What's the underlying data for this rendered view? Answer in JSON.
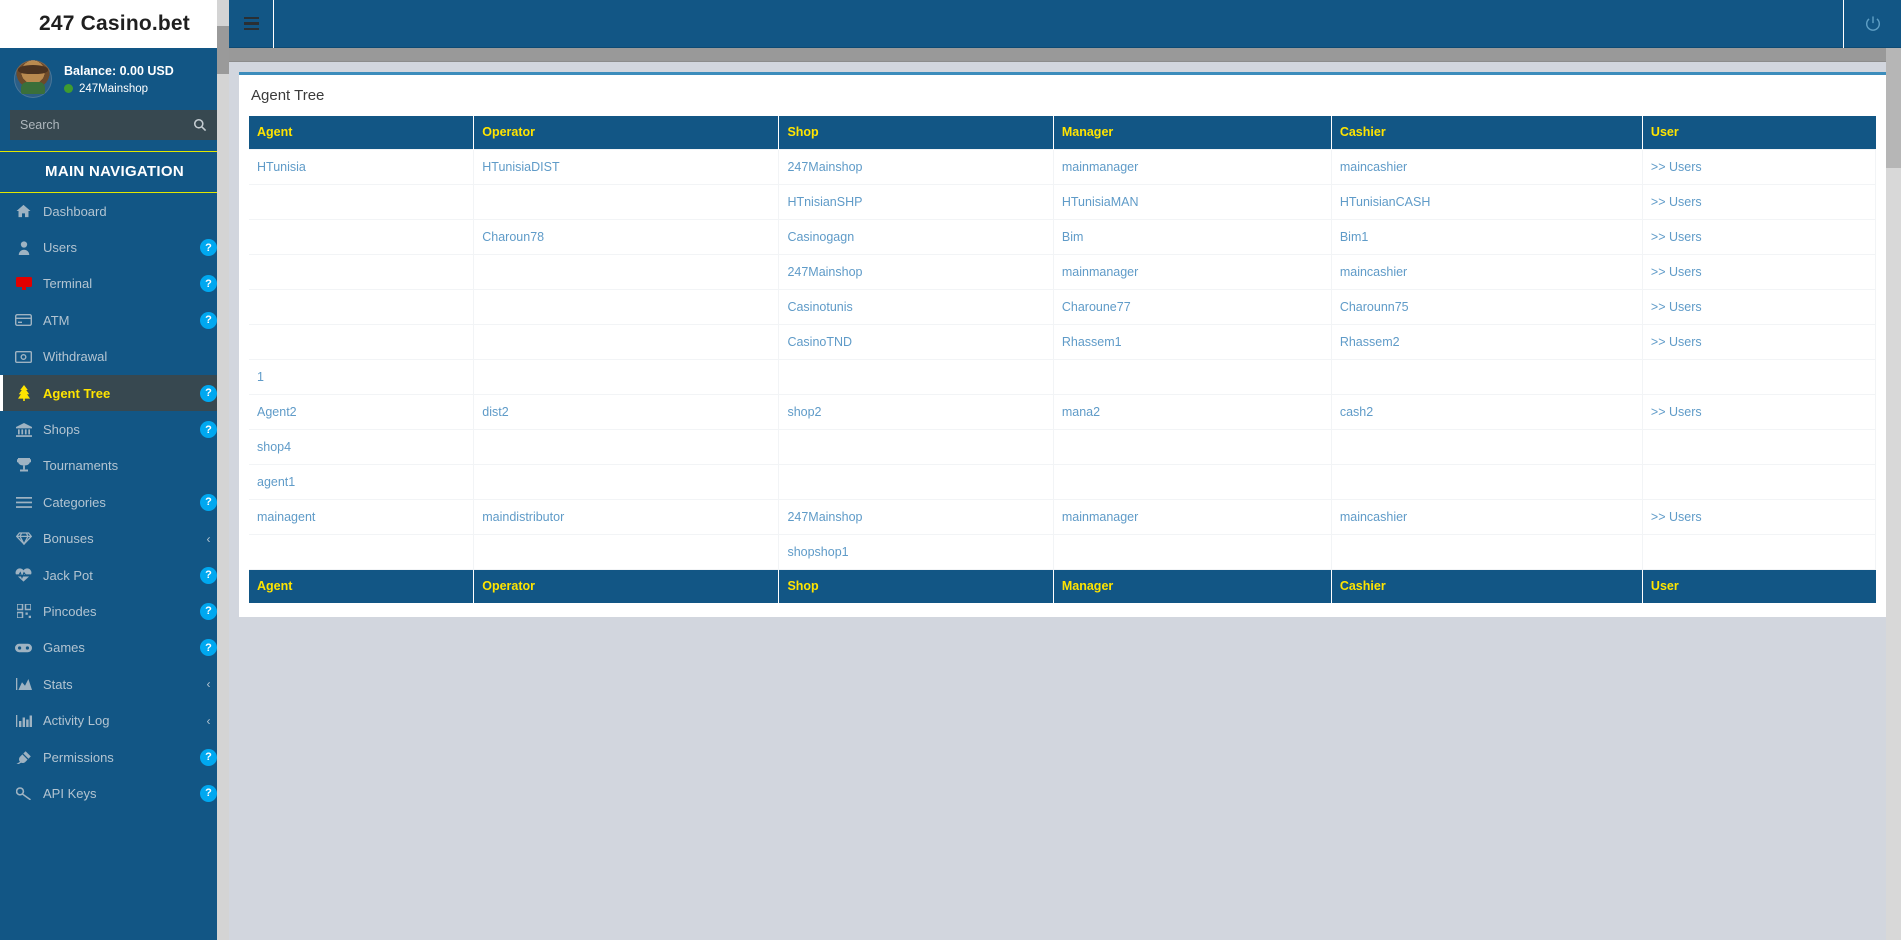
{
  "brand": {
    "name": "247 Casino.bet"
  },
  "user_panel": {
    "balance": "Balance: 0.00 USD",
    "shop": "247Mainshop",
    "status_color": "#3f9b30"
  },
  "search": {
    "placeholder": "Search",
    "value": "",
    "icon": "search-icon"
  },
  "sidebar": {
    "header": "MAIN NAVIGATION",
    "items": [
      {
        "label": "Dashboard",
        "icon": "home-icon",
        "badge": "",
        "chevron": false,
        "active": false
      },
      {
        "label": "Users",
        "icon": "user-icon",
        "badge": "?",
        "chevron": false,
        "active": false
      },
      {
        "label": "Terminal",
        "icon": "monitor-icon",
        "badge": "?",
        "chevron": false,
        "active": false
      },
      {
        "label": "ATM",
        "icon": "card-icon",
        "badge": "?",
        "chevron": false,
        "active": false
      },
      {
        "label": "Withdrawal",
        "icon": "money-icon",
        "badge": "",
        "chevron": false,
        "active": false
      },
      {
        "label": "Agent Tree",
        "icon": "tree-icon",
        "badge": "?",
        "chevron": false,
        "active": true
      },
      {
        "label": "Shops",
        "icon": "bank-icon",
        "badge": "?",
        "chevron": false,
        "active": false
      },
      {
        "label": "Tournaments",
        "icon": "trophy-icon",
        "badge": "",
        "chevron": false,
        "active": false
      },
      {
        "label": "Categories",
        "icon": "list-icon",
        "badge": "?",
        "chevron": false,
        "active": false
      },
      {
        "label": "Bonuses",
        "icon": "gem-icon",
        "badge": "",
        "chevron": true,
        "active": false
      },
      {
        "label": "Jack Pot",
        "icon": "heartbeat-icon",
        "badge": "?",
        "chevron": false,
        "active": false
      },
      {
        "label": "Pincodes",
        "icon": "qrcode-icon",
        "badge": "?",
        "chevron": false,
        "active": false
      },
      {
        "label": "Games",
        "icon": "gamepad-icon",
        "badge": "?",
        "chevron": false,
        "active": false
      },
      {
        "label": "Stats",
        "icon": "area-chart-icon",
        "badge": "",
        "chevron": true,
        "active": false
      },
      {
        "label": "Activity Log",
        "icon": "bar-chart-icon",
        "badge": "",
        "chevron": true,
        "active": false
      },
      {
        "label": "Permissions",
        "icon": "plug-icon",
        "badge": "?",
        "chevron": false,
        "active": false
      },
      {
        "label": "API Keys",
        "icon": "key-icon",
        "badge": "?",
        "chevron": false,
        "active": false
      }
    ]
  },
  "topbar": {
    "menu_toggle_icon": "hamburger-icon",
    "logout_icon": "power-icon"
  },
  "page": {
    "title": "Agent Tree"
  },
  "table": {
    "columns": [
      "Agent",
      "Operator",
      "Shop",
      "Manager",
      "Cashier",
      "User"
    ],
    "user_link_label": ">> Users",
    "rows": [
      {
        "agent": "HTunisia",
        "operator": "HTunisiaDIST",
        "shop": "247Mainshop",
        "manager": "mainmanager",
        "cashier": "maincashier",
        "user": ">> Users"
      },
      {
        "agent": "",
        "operator": "",
        "shop": "HTnisianSHP",
        "manager": "HTunisiaMAN",
        "cashier": "HTunisianCASH",
        "user": ">> Users"
      },
      {
        "agent": "",
        "operator": "Charoun78",
        "shop": "Casinogagn",
        "manager": "Bim",
        "cashier": "Bim1",
        "user": ">> Users"
      },
      {
        "agent": "",
        "operator": "",
        "shop": "247Mainshop",
        "manager": "mainmanager",
        "cashier": "maincashier",
        "user": ">> Users"
      },
      {
        "agent": "",
        "operator": "",
        "shop": "Casinotunis",
        "manager": "Charoune77",
        "cashier": "Charounn75",
        "user": ">> Users"
      },
      {
        "agent": "",
        "operator": "",
        "shop": "CasinoTND",
        "manager": "Rhassem1",
        "cashier": "Rhassem2",
        "user": ">> Users"
      },
      {
        "agent": "1",
        "operator": "",
        "shop": "",
        "manager": "",
        "cashier": "",
        "user": ""
      },
      {
        "agent": "Agent2",
        "operator": "dist2",
        "shop": "shop2",
        "manager": "mana2",
        "cashier": "cash2",
        "user": ">> Users"
      },
      {
        "agent": "shop4",
        "operator": "",
        "shop": "",
        "manager": "",
        "cashier": "",
        "user": ""
      },
      {
        "agent": "agent1",
        "operator": "",
        "shop": "",
        "manager": "",
        "cashier": "",
        "user": ""
      },
      {
        "agent": "mainagent",
        "operator": "maindistributor",
        "shop": "247Mainshop",
        "manager": "mainmanager",
        "cashier": "maincashier",
        "user": ">> Users"
      },
      {
        "agent": "",
        "operator": "",
        "shop": "shopshop1",
        "manager": "",
        "cashier": "",
        "user": ""
      }
    ]
  },
  "colors": {
    "sidebar_bg": "#125685",
    "header_bg": "#125685",
    "accent_yellow": "#ffe400",
    "link_blue": "#5f9bc8",
    "box_top_border": "#3c8dbc",
    "content_bg": "#d2d6de",
    "active_item_bg": "#374850",
    "badge_blue": "#00a8f0"
  }
}
